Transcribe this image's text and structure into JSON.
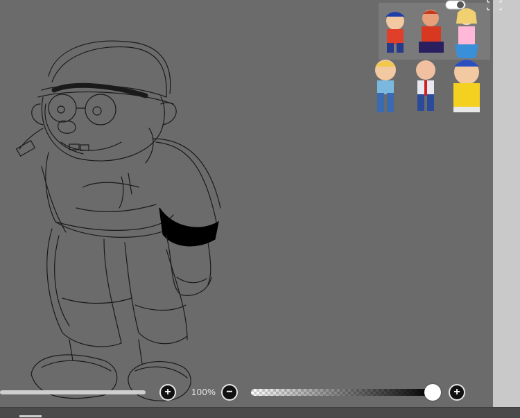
{
  "toolbar": {
    "zoom_label": "100%",
    "zoom_out_symbol": "−",
    "zoom_in_symbol": "+",
    "brush_size_plus_symbol": "+"
  },
  "icons": {
    "brush_size_plus": "plus-icon",
    "zoom_out": "minus-icon",
    "zoom_in": "plus-icon",
    "toggle": "toggle-icon",
    "expand": "expand-icon"
  },
  "colors": {
    "canvas": "#6b6b6b",
    "side_panel": "#c9c9c9",
    "bottom_bar": "#4a4a4a",
    "sketch_stroke": "#1a1a1a"
  },
  "opacity_level": 1.0
}
